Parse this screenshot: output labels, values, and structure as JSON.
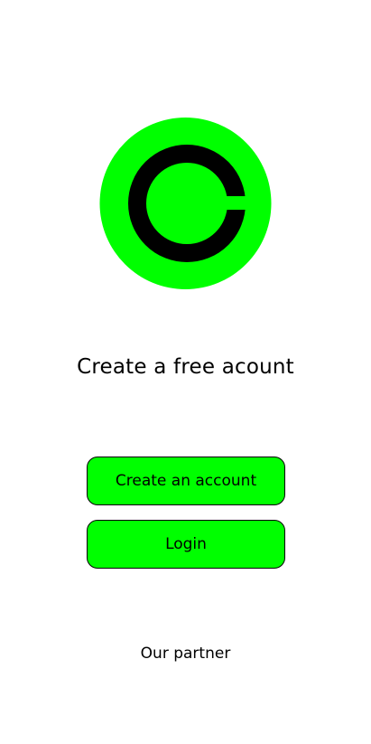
{
  "colors": {
    "accent": "#00ff00",
    "text": "#000000",
    "background": "#ffffff"
  },
  "logo": {
    "icon": "brand-c-logo-icon"
  },
  "headline": "Create a free acount",
  "buttons": {
    "create_account_label": "Create an account",
    "login_label": "Login"
  },
  "partner": {
    "label": "Our partner"
  }
}
